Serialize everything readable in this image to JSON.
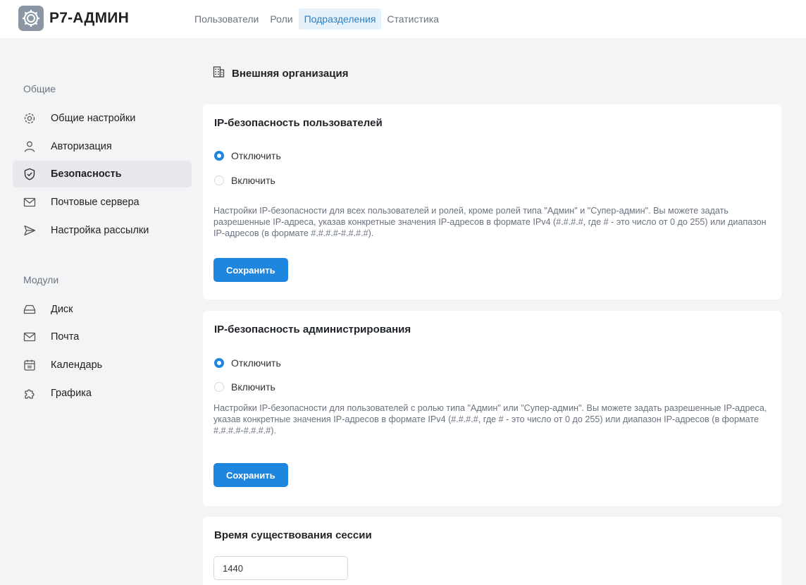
{
  "app": {
    "logo_text": "Р7-АДМИН"
  },
  "topnav": [
    {
      "label": "Пользователи"
    },
    {
      "label": "Роли"
    },
    {
      "label": "Подразделения",
      "active": true
    },
    {
      "label": "Статистика"
    }
  ],
  "sidebar": {
    "general_title": "Общие",
    "general_items": [
      {
        "label": "Общие настройки",
        "icon": "gear-icon"
      },
      {
        "label": "Авторизация",
        "icon": "user-icon"
      },
      {
        "label": "Безопасность",
        "icon": "shield-icon",
        "active": true
      },
      {
        "label": "Почтовые сервера",
        "icon": "envelope-icon"
      },
      {
        "label": "Настройка рассылки",
        "icon": "send-icon"
      }
    ],
    "modules_title": "Модули",
    "module_items": [
      {
        "label": "Диск",
        "icon": "disk-icon"
      },
      {
        "label": "Почта",
        "icon": "envelope-icon"
      },
      {
        "label": "Календарь",
        "icon": "calendar-icon"
      },
      {
        "label": "Графика",
        "icon": "puzzle-icon"
      }
    ]
  },
  "main": {
    "page_title": "Внешняя организация",
    "user_ip": {
      "title": "IP-безопасность пользователей",
      "options": [
        "Отключить",
        "Включить"
      ],
      "selected": "Отключить",
      "description": "Настройки IP-безопасности для всех пользователей и ролей, кроме ролей типа \"Админ\" и \"Супер-админ\". Вы можете задать разрешенные IP-адреса, указав конкретные значения IP-адресов в формате IPv4 (#.#.#.#, где # - это число от 0 до 255) или диапазон IP-адресов (в формате #.#.#.#-#.#.#.#).",
      "save_label": "Сохранить"
    },
    "admin_ip": {
      "title": "IP-безопасность администрирования",
      "options": [
        "Отключить",
        "Включить"
      ],
      "selected": "Отключить",
      "description": "Настройки IP-безопасности для пользователей с ролью типа \"Админ\" или \"Супер-админ\". Вы можете задать разрешенные IP-адреса, указав конкретные значения IP-адресов в формате IPv4 (#.#.#.#, где # - это число от 0 до 255) или диапазон IP-адресов (в формате #.#.#.#-#.#.#.#).",
      "save_label": "Сохранить"
    },
    "session": {
      "title": "Время существования сессии",
      "value": "1440"
    }
  },
  "colors": {
    "accent": "#1f86e0",
    "active_tab_bg": "#e6f2fb",
    "active_tab_text": "#2a7fc4"
  }
}
